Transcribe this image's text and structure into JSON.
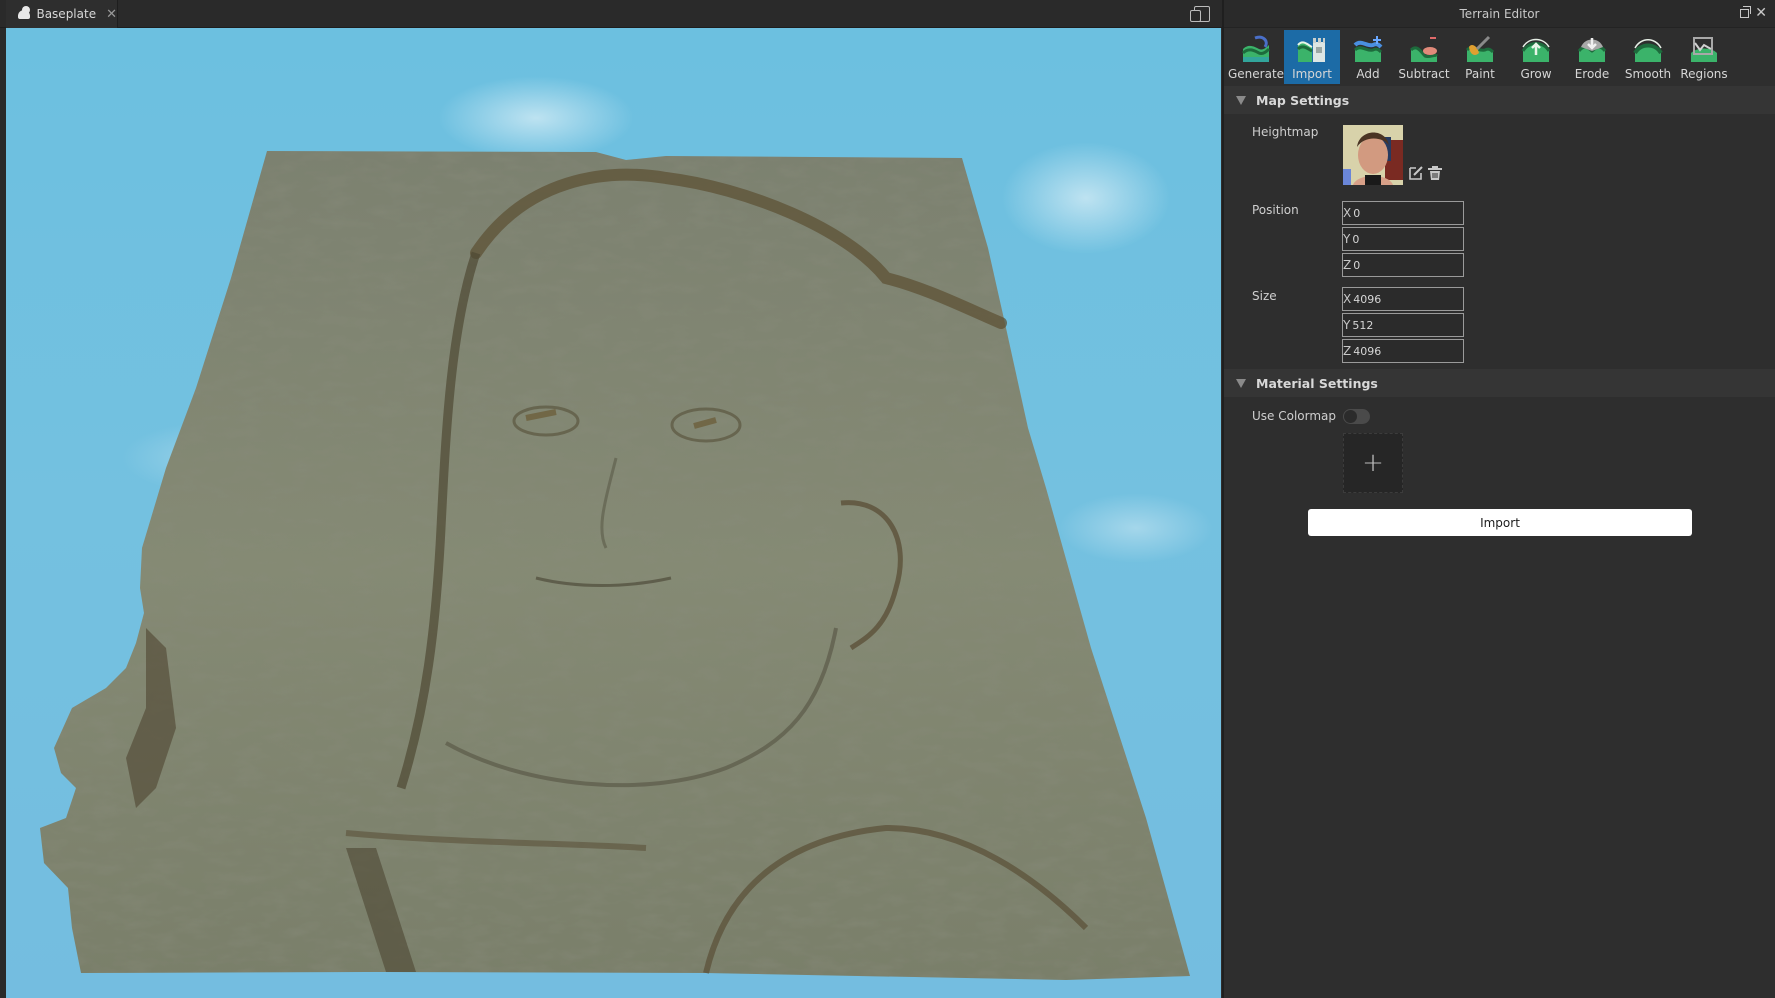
{
  "document_tab": {
    "label": "Baseplate",
    "icon": "cloud-icon",
    "close_glyph": "✕"
  },
  "viewport": {
    "description": "3D terrain generated from heightmap of a face",
    "sky_color": "#74c1e0",
    "terrain_color": "#7f8470"
  },
  "panel": {
    "title": "Terrain Editor",
    "close_glyph": "✕",
    "tools": [
      {
        "label": "Generate",
        "icon": "generate-icon",
        "active": false
      },
      {
        "label": "Import",
        "icon": "import-icon",
        "active": true
      },
      {
        "label": "Add",
        "icon": "add-icon",
        "active": false
      },
      {
        "label": "Subtract",
        "icon": "subtract-icon",
        "active": false
      },
      {
        "label": "Paint",
        "icon": "paint-icon",
        "active": false
      },
      {
        "label": "Grow",
        "icon": "grow-icon",
        "active": false
      },
      {
        "label": "Erode",
        "icon": "erode-icon",
        "active": false
      },
      {
        "label": "Smooth",
        "icon": "smooth-icon",
        "active": false
      },
      {
        "label": "Regions",
        "icon": "regions-icon",
        "active": false
      }
    ],
    "active_color": "#1c6ba6",
    "map_settings": {
      "header": "Map Settings",
      "heightmap_label": "Heightmap",
      "position_label": "Position",
      "position": {
        "x": "0",
        "y": "0",
        "z": "0"
      },
      "size_label": "Size",
      "size": {
        "x": "4096",
        "y": "512",
        "z": "4096"
      },
      "axis_labels": {
        "x": "X",
        "y": "Y",
        "z": "Z"
      }
    },
    "material_settings": {
      "header": "Material Settings",
      "use_colormap_label": "Use Colormap",
      "use_colormap": false,
      "add_glyph": "+"
    },
    "import_button": "Import"
  }
}
